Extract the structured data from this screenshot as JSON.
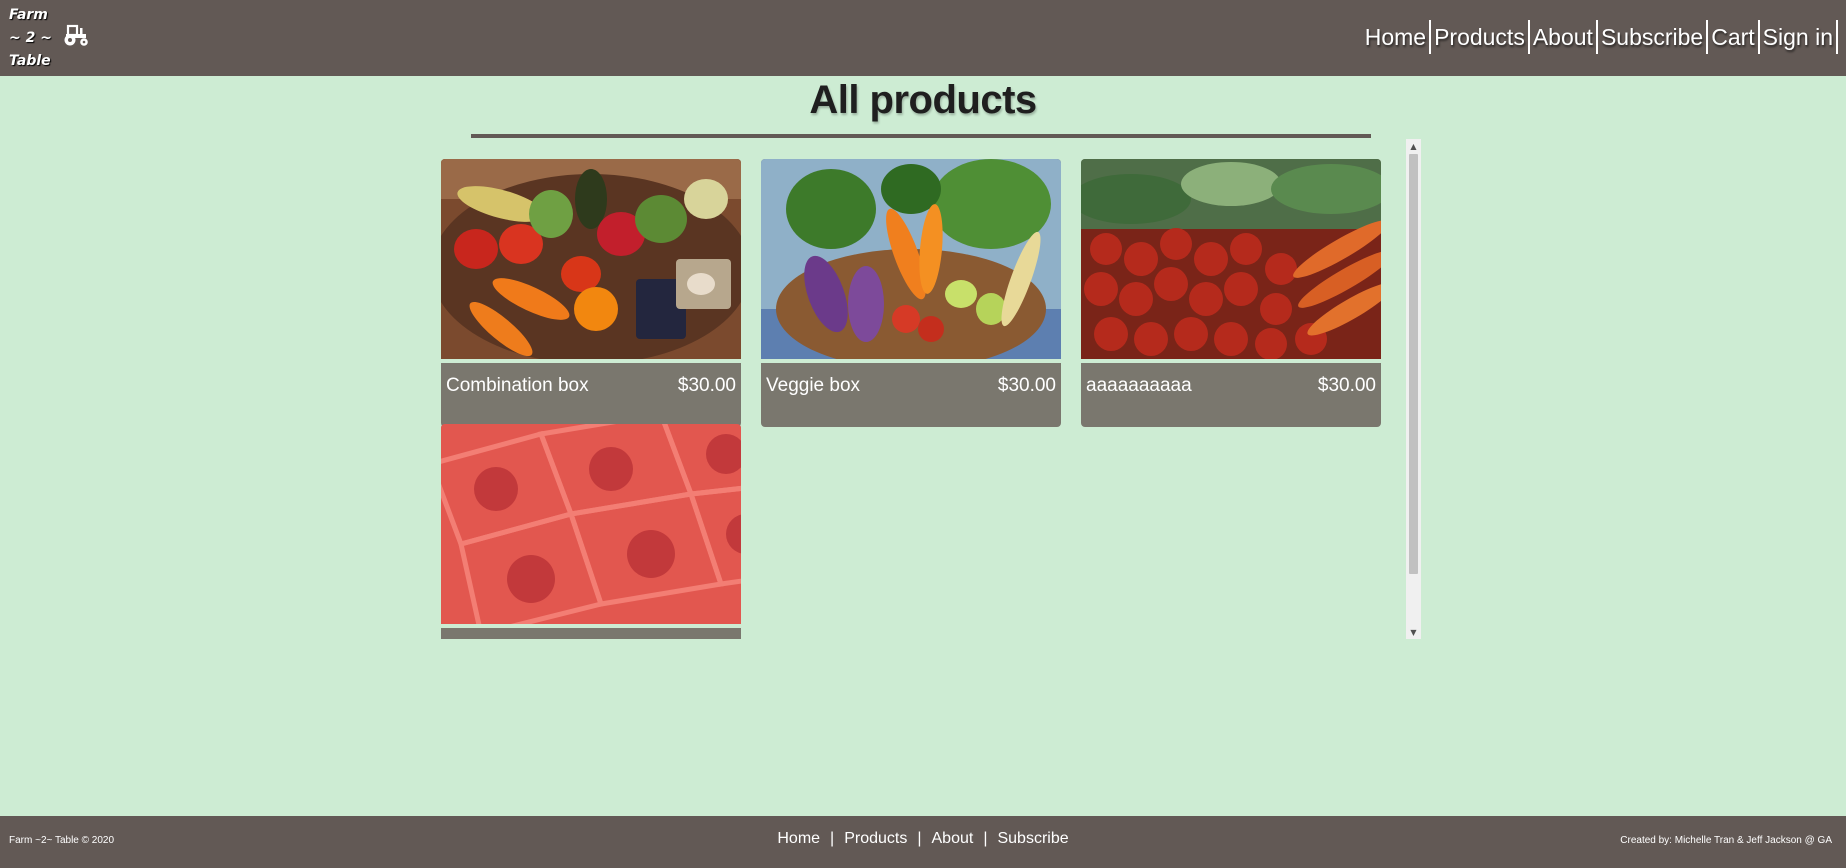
{
  "header": {
    "logo_lines": [
      "Farm",
      "~ 2 ~",
      "Table"
    ],
    "nav": [
      "Home",
      "Products",
      "About",
      "Subscribe",
      "Cart",
      "Sign in"
    ]
  },
  "main": {
    "title": "All products",
    "products": [
      {
        "name": "Combination box",
        "price": "$30.00"
      },
      {
        "name": "Veggie box",
        "price": "$30.00"
      },
      {
        "name": "aaaaaaaaaa",
        "price": "$30.00"
      },
      {
        "name": "",
        "price": ""
      }
    ]
  },
  "footer": {
    "copyright": "Farm ~2~ Table © 2020",
    "nav": [
      "Home",
      "Products",
      "About",
      "Subscribe"
    ],
    "credit": "Created by: Michelle Tran & Jeff Jackson @ GA"
  },
  "colors": {
    "background": "#cdecd3",
    "header_bg": "#625955",
    "card_footer_bg": "#7a776e"
  }
}
